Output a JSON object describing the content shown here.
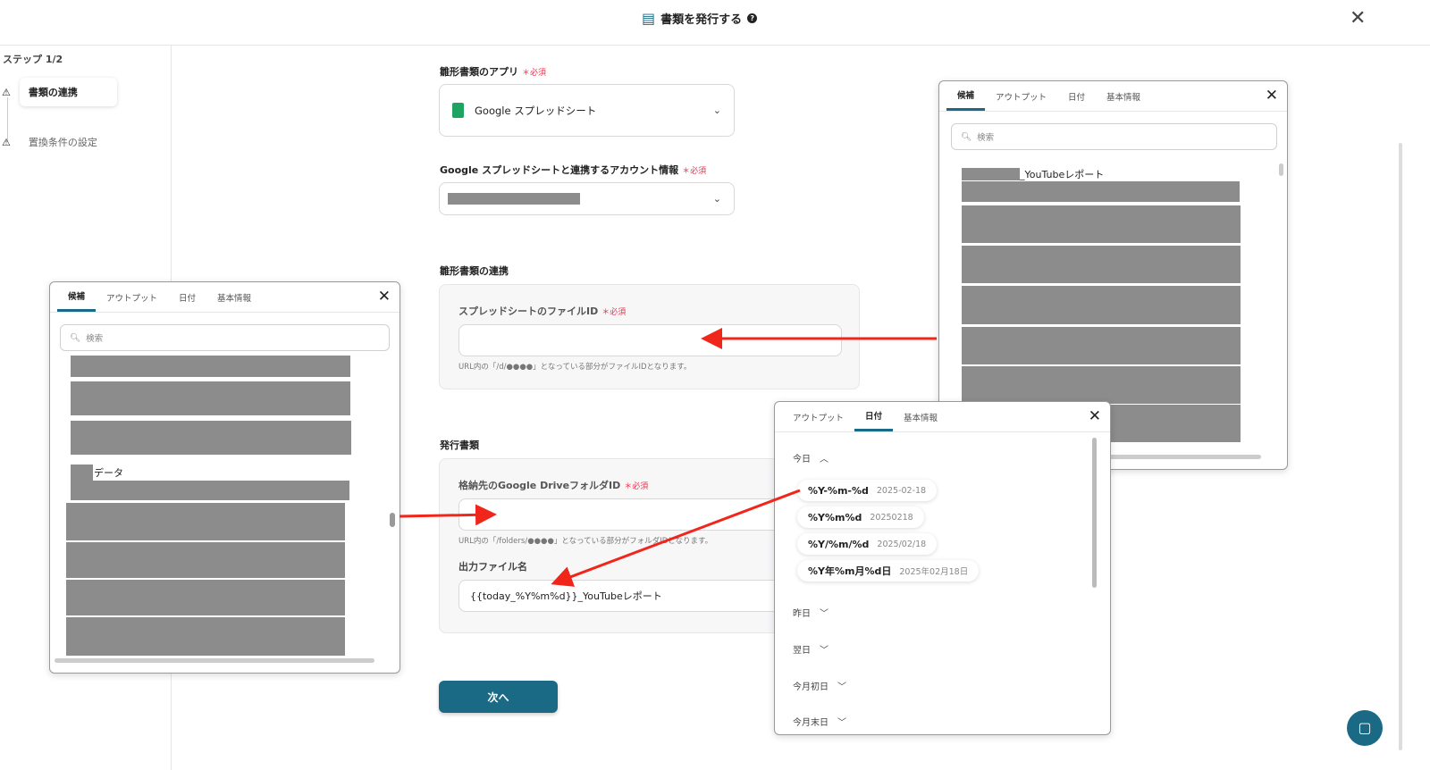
{
  "header": {
    "title": "書類を発行する",
    "help_icon": "question-circle-icon"
  },
  "sidebar": {
    "step": "ステップ 1/2",
    "items": [
      {
        "label": "書類の連携",
        "active": true
      },
      {
        "label": "置換条件の設定",
        "active": false
      }
    ]
  },
  "form": {
    "app_label": "雛形書類のアプリ",
    "required": "＊必須",
    "app_value": "Google スプレッドシート",
    "account_label": "Google スプレッドシートと連携するアカウント情報",
    "template_section": "雛形書類の連携",
    "file_id_label": "スプレッドシートのファイルID",
    "file_id_hint": "URL内の「/d/●●●●」となっている部分がファイルIDとなります。",
    "issue_section": "発行書類",
    "folder_label": "格納先のGoogle DriveフォルダID",
    "folder_hint": "URL内の「/folders/●●●●」となっている部分がフォルダIDとなります。",
    "filename_label": "出力ファイル名",
    "filename_value": "{{today_%Y%m%d}}_YouTubeレポート",
    "next_button": "次へ"
  },
  "popup_left": {
    "tabs": [
      "候補",
      "アウトプット",
      "日付",
      "基本情報"
    ],
    "active_tab": "候補",
    "search_placeholder": "検索",
    "item_label": "データ"
  },
  "popup_right": {
    "tabs": [
      "候補",
      "アウトプット",
      "日付",
      "基本情報"
    ],
    "active_tab": "候補",
    "search_placeholder": "検索",
    "item_label": "_YouTubeレポート"
  },
  "popup_date": {
    "tabs": [
      "アウトプット",
      "日付",
      "基本情報"
    ],
    "active_tab": "日付",
    "groups": [
      "今日",
      "昨日",
      "翌日",
      "今月初日",
      "今月末日"
    ],
    "today_formats": [
      {
        "format": "%Y-%m-%d",
        "example": "2025-02-18"
      },
      {
        "format": "%Y%m%d",
        "example": "20250218"
      },
      {
        "format": "%Y/%m/%d",
        "example": "2025/02/18"
      },
      {
        "format": "%Y年%m月%d日",
        "example": "2025年02月18日"
      }
    ]
  },
  "colors": {
    "accent": "#1b6a85",
    "required": "#e6334f",
    "arrow": "#f0261b"
  }
}
